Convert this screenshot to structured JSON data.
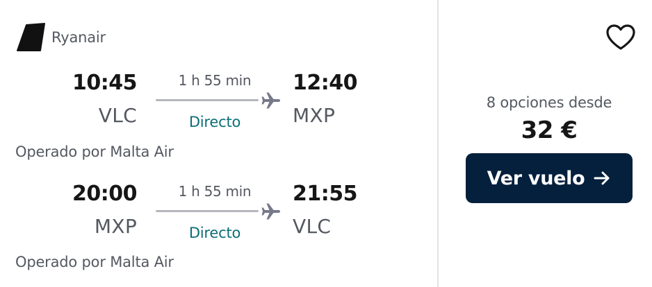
{
  "airline": {
    "name": "Ryanair",
    "logo_icon": "ryanair-tail-logo-icon"
  },
  "outbound": {
    "dep_time": "10:45",
    "dep_code": "VLC",
    "duration": "1 h 55 min",
    "stops": "Directo",
    "arr_time": "12:40",
    "arr_code": "MXP",
    "operated_by": "Operado por Malta Air"
  },
  "return": {
    "dep_time": "20:00",
    "dep_code": "MXP",
    "duration": "1 h 55 min",
    "stops": "Directo",
    "arr_time": "21:55",
    "arr_code": "VLC",
    "operated_by": "Operado por Malta Air"
  },
  "pricing": {
    "options_text": "8 opciones desde",
    "price": "32 €",
    "cta_label": "Ver vuelo",
    "cta_icon": "arrow-right-icon",
    "favorite_icon": "heart-outline-icon"
  },
  "colors": {
    "cta_background": "#05203c",
    "stops_text": "#0b6e77",
    "secondary_text": "#545860",
    "divider": "#e2e2e6"
  }
}
